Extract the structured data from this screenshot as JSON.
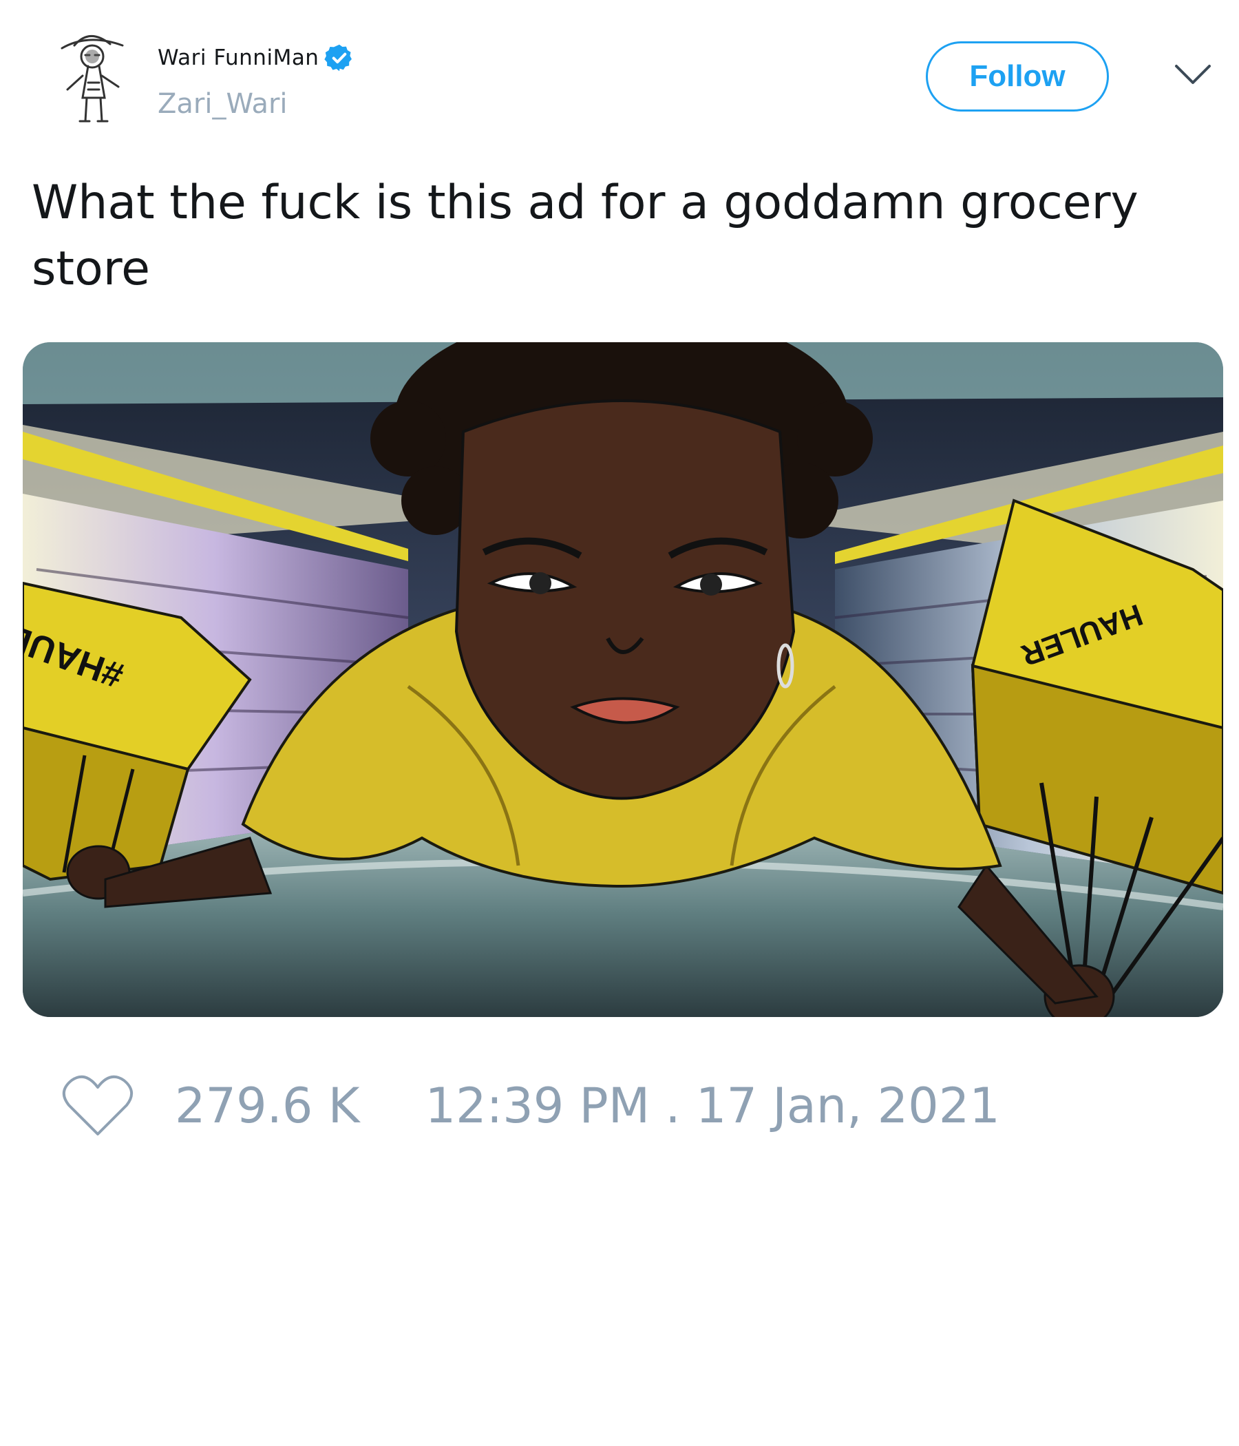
{
  "author": {
    "display_name": "Wari FunniMan",
    "handle": "Zari_Wari",
    "verified": true,
    "avatar_icon": "sketch-figure-avatar"
  },
  "header": {
    "follow_label": "Follow",
    "menu_icon": "chevron-down-icon"
  },
  "tweet": {
    "text": "What the fuck is this ad for a goddamn grocery store"
  },
  "media": {
    "type": "image",
    "bag_text_left": "#HAUL",
    "bag_text_right": "HAULER"
  },
  "footer": {
    "like_icon": "heart-icon",
    "like_count": "279.6 K",
    "timestamp": "12:39 PM . 17 Jan, 2021"
  },
  "colors": {
    "accent": "#1da1f2",
    "muted": "#8fa1b3",
    "text": "#14171a",
    "bag_yellow": "#e3cf26"
  }
}
